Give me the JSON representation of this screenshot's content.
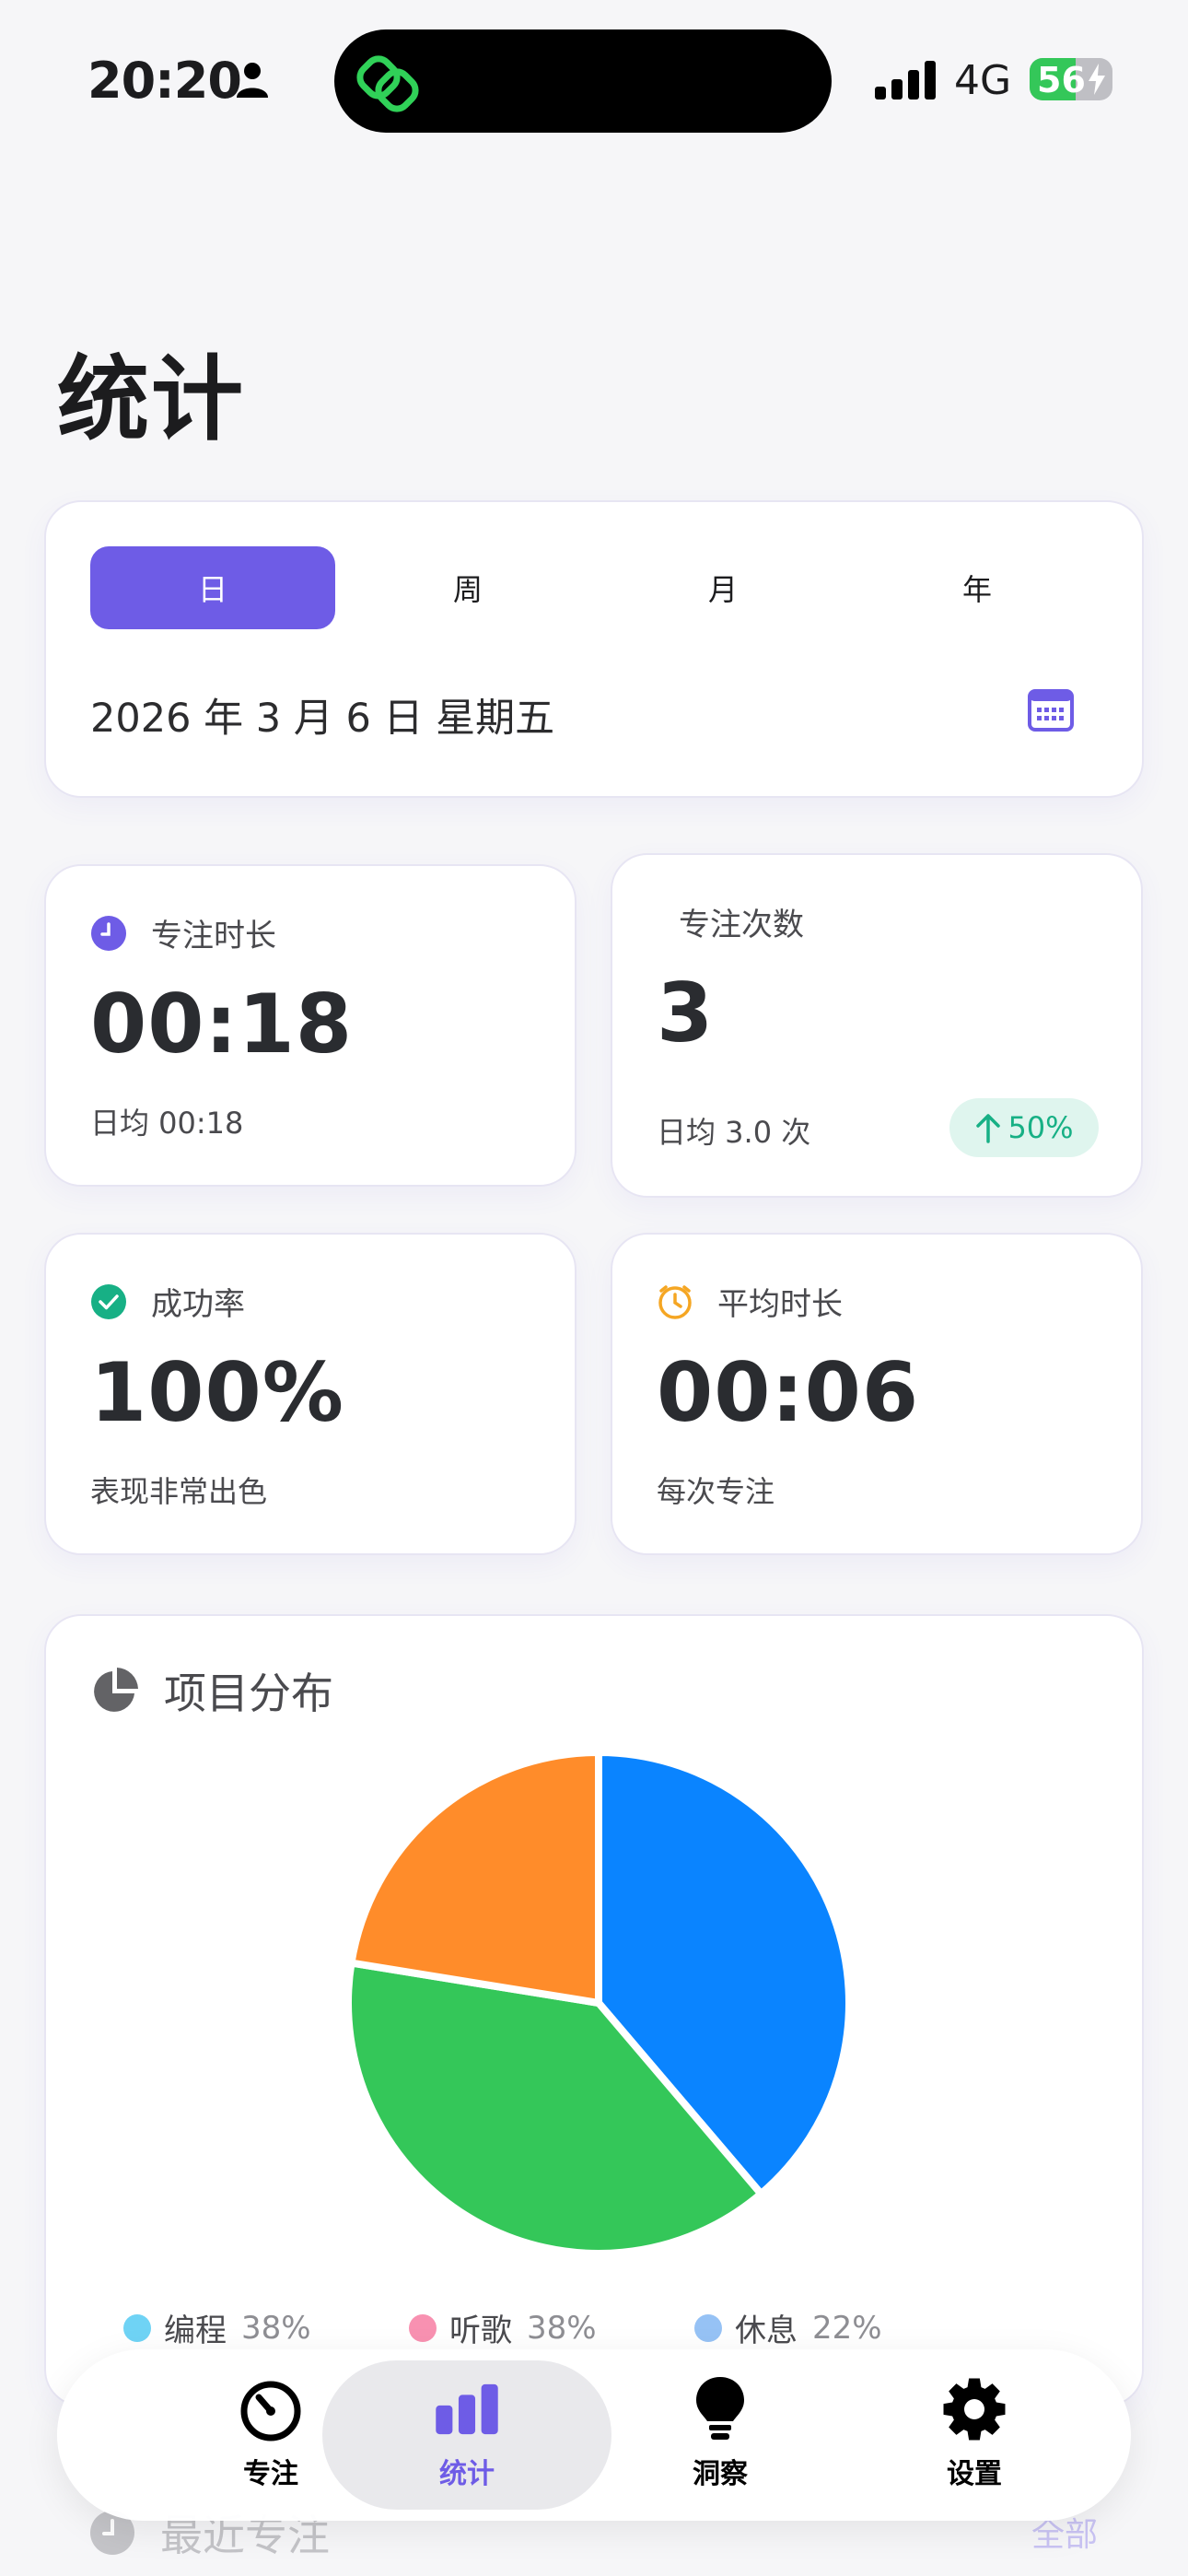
{
  "status_bar": {
    "time": "20:20",
    "network": "4G",
    "battery": "56",
    "battery_level": 0.56
  },
  "page": {
    "title": "统计"
  },
  "period_tabs": [
    {
      "label": "日",
      "active": true
    },
    {
      "label": "周",
      "active": false
    },
    {
      "label": "月",
      "active": false
    },
    {
      "label": "年",
      "active": false
    }
  ],
  "date_display": "2026 年 3 月 6 日  星期五",
  "stats": {
    "focus_duration": {
      "title": "专注时长",
      "value": "00:18",
      "sub": "日均 00:18",
      "icon": "clock-icon"
    },
    "focus_count": {
      "title": "专注次数",
      "value": "3",
      "sub": "日均 3.0 次",
      "trend": "50%"
    },
    "success_rate": {
      "title": "成功率",
      "value": "100%",
      "sub": "表现非常出色",
      "icon": "check-circle-icon"
    },
    "avg_duration": {
      "title": "平均时长",
      "value": "00:06",
      "sub": "每次专注",
      "icon": "timer-icon"
    }
  },
  "distribution": {
    "title": "项目分布",
    "slices_pie": [
      {
        "value": 38,
        "color": "#0a84ff"
      },
      {
        "value": 38,
        "color": "#34c759"
      },
      {
        "value": 22,
        "color": "#ff8c2a"
      }
    ],
    "legend": [
      {
        "name": "编程",
        "pct": "38%",
        "color": "#6fd3f5"
      },
      {
        "name": "听歌",
        "pct": "38%",
        "color": "#f891b1"
      },
      {
        "name": "休息",
        "pct": "22%",
        "color": "#96c2f5"
      }
    ]
  },
  "recent": {
    "title": "最近专注",
    "all_label": "全部"
  },
  "tab_bar": [
    {
      "label": "专注",
      "icon": "timer-icon",
      "active": false
    },
    {
      "label": "统计",
      "icon": "bar-chart-icon",
      "active": true
    },
    {
      "label": "洞察",
      "icon": "lightbulb-icon",
      "active": false
    },
    {
      "label": "设置",
      "icon": "gear-icon",
      "active": false
    }
  ],
  "colors": {
    "accent": "#6e5ce6",
    "success": "#17b085",
    "warning": "#f5a623"
  }
}
